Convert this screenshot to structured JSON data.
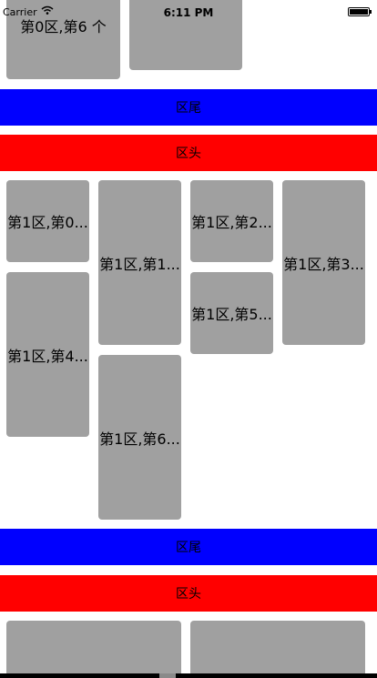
{
  "status": {
    "carrier": "Carrier",
    "time": "6:11 PM"
  },
  "section0": {
    "cell_label": "第0区,第6 个",
    "footer": "区尾"
  },
  "section1": {
    "header": "区头",
    "cells": [
      "第1区,第0...",
      "第1区,第1...",
      "第1区,第2...",
      "第1区,第3...",
      "第1区,第4...",
      "第1区,第5...",
      "第1区,第6..."
    ],
    "footer": "区尾"
  },
  "section2": {
    "header": "区头"
  },
  "colors": {
    "footer": "#0000ff",
    "header": "#ff0000",
    "cell": "#a0a0a0"
  }
}
